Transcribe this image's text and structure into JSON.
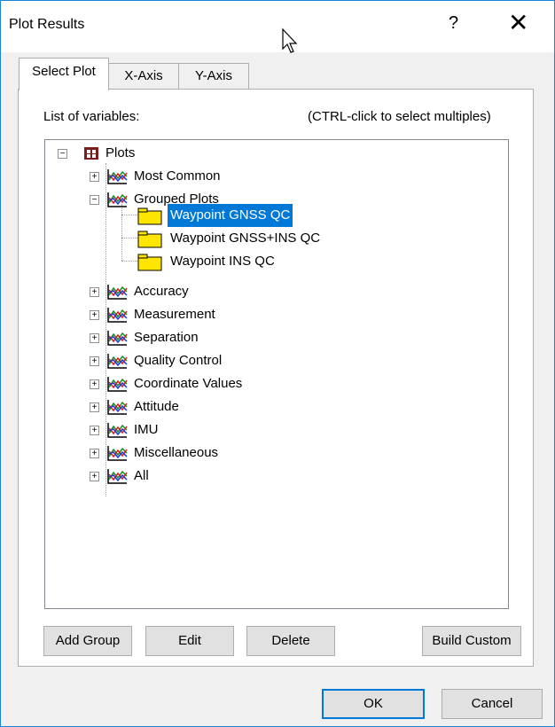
{
  "window": {
    "title": "Plot Results",
    "help_label": "?",
    "close_label": "✕"
  },
  "tabs": [
    {
      "label": "Select Plot"
    },
    {
      "label": "X-Axis"
    },
    {
      "label": "Y-Axis"
    }
  ],
  "panel": {
    "list_label": "List of variables:",
    "hint": "(CTRL-click to select multiples)"
  },
  "tree": {
    "root": "Plots",
    "children": [
      {
        "label": "Most Common"
      },
      {
        "label": "Grouped Plots",
        "children": [
          {
            "label": "Waypoint GNSS QC",
            "selected": true
          },
          {
            "label": "Waypoint GNSS+INS QC"
          },
          {
            "label": "Waypoint INS QC"
          }
        ]
      },
      {
        "label": "Accuracy"
      },
      {
        "label": "Measurement"
      },
      {
        "label": "Separation"
      },
      {
        "label": "Quality Control"
      },
      {
        "label": "Coordinate Values"
      },
      {
        "label": "Attitude"
      },
      {
        "label": "IMU"
      },
      {
        "label": "Miscellaneous"
      },
      {
        "label": "All"
      }
    ]
  },
  "panel_buttons": {
    "add_group": "Add Group",
    "edit": "Edit",
    "delete": "Delete",
    "build_custom": "Build Custom"
  },
  "dialog_buttons": {
    "ok": "OK",
    "cancel": "Cancel"
  },
  "colors": {
    "selection": "#0078d7",
    "folder": "#ffe600"
  }
}
